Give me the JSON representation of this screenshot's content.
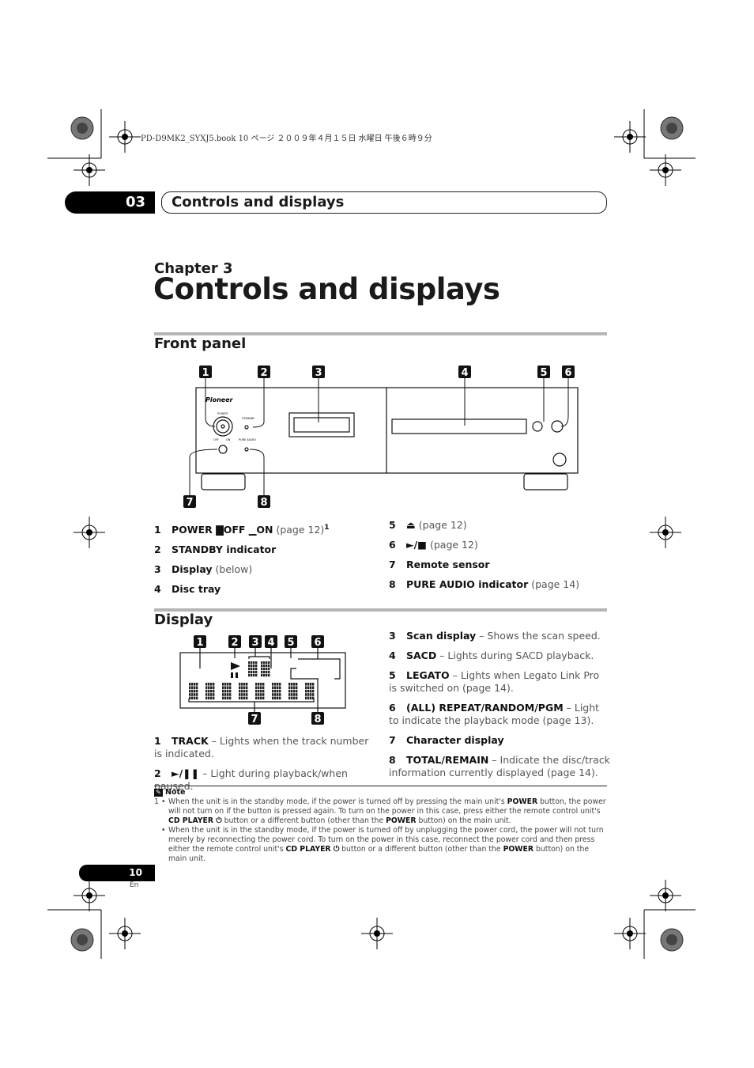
{
  "print_header": "PD-D9MK2_SYXJ5.book  10 ページ  ２００９年４月１５日  水曜日  午後６時９分",
  "chapter_tab": {
    "number": "03",
    "title": "Controls and displays"
  },
  "chapter_label": "Chapter 3",
  "page_title": "Controls and displays",
  "front_panel": {
    "heading": "Front panel",
    "illustration": {
      "callouts": [
        "1",
        "2",
        "3",
        "4",
        "5",
        "6",
        "7",
        "8"
      ],
      "brand_logo": "Pioneer",
      "labels": {
        "power": "POWER",
        "standby": "STANDBY",
        "off": "OFF",
        "on": "ON",
        "pure_audio": "PURE AUDIO"
      }
    },
    "items_left": [
      {
        "n": "1",
        "bold": "POWER ▇OFF ▁ON",
        "normal": " (page 12)",
        "sup": "1"
      },
      {
        "n": "2",
        "bold": "STANDBY indicator",
        "normal": ""
      },
      {
        "n": "3",
        "bold": "Display",
        "normal": " (below)"
      },
      {
        "n": "4",
        "bold": "Disc tray",
        "normal": ""
      }
    ],
    "items_right": [
      {
        "n": "5",
        "bold": "⏏",
        "normal": " (page 12)"
      },
      {
        "n": "6",
        "bold": "►/■",
        "normal": " (page 12)"
      },
      {
        "n": "7",
        "bold": "Remote sensor",
        "normal": ""
      },
      {
        "n": "8",
        "bold": "PURE AUDIO indicator",
        "normal": " (page 14)"
      }
    ]
  },
  "display": {
    "heading": "Display",
    "illustration": {
      "callouts": [
        "1",
        "2",
        "3",
        "4",
        "5",
        "6",
        "7",
        "8"
      ]
    },
    "items_left": [
      {
        "n": "1",
        "bold": "TRACK",
        "normal": " – Lights when the track number is indicated."
      },
      {
        "n": "2",
        "bold": "►/❚❚",
        "normal": " – Light during playback/when paused."
      }
    ],
    "items_right": [
      {
        "n": "3",
        "bold": "Scan display",
        "normal": " – Shows the scan speed."
      },
      {
        "n": "4",
        "bold": "SACD",
        "normal": " – Lights during SACD playback."
      },
      {
        "n": "5",
        "bold": "LEGATO",
        "normal": " – Lights when Legato Link Pro is switched on (page 14)."
      },
      {
        "n": "6",
        "bold": "(ALL) REPEAT/RANDOM/PGM",
        "normal": " – Light to indicate the playback mode (page 13)."
      },
      {
        "n": "7",
        "bold": "Character display",
        "normal": ""
      },
      {
        "n": "8",
        "bold": "TOTAL/REMAIN",
        "normal": " – Indicate the disc/track information currently displayed (page 14)."
      }
    ]
  },
  "note": {
    "heading": "Note",
    "footnote_num": "1",
    "bullets": [
      {
        "a": "When the unit is in the standby mode, if the power is turned off by pressing the main unit's ",
        "b1": "POWER",
        "c": " button, the power will not turn on if the button is pressed again. To turn on the power in this case, press either the remote control unit's ",
        "b2": "CD PLAYER ⏻",
        "d": " button or a different button (other than the ",
        "b3": "POWER",
        "e": " button) on the main unit."
      },
      {
        "a": "When the unit is in the standby mode, if the power is turned off by unplugging the power cord, the power will not turn merely by reconnecting the power cord. To turn on the power in this case, reconnect the power cord and then press either the remote control unit's ",
        "b1": "CD PLAYER ⏻",
        "c": " button or a different button (other than the ",
        "b2": "POWER",
        "d": " button) on the main unit."
      }
    ]
  },
  "page_number": "10",
  "language": "En"
}
